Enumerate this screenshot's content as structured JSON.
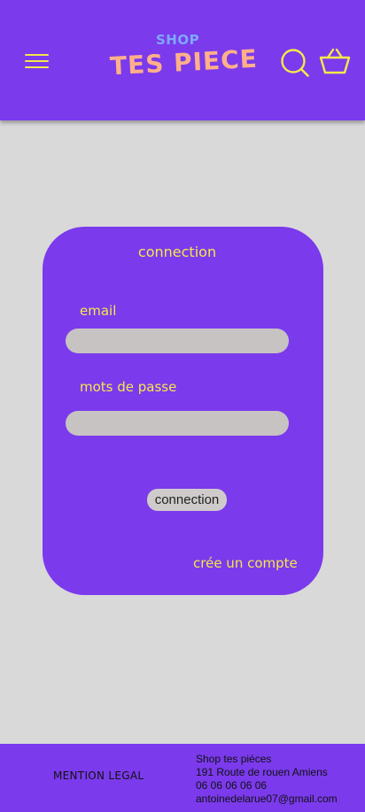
{
  "header": {
    "logo_top": "SHOP",
    "logo_main": "TES PIECE",
    "menu_icon": "hamburger-menu-icon",
    "search_icon": "search-icon",
    "basket_icon": "basket-icon"
  },
  "login": {
    "title": "connection",
    "email_label": "email",
    "email_value": "",
    "password_label": "mots de passe",
    "password_value": "",
    "submit_label": "connection",
    "create_account": "crée un compte"
  },
  "footer": {
    "legal": "MENTION LEGAL",
    "shop_name": "Shop tes piéces",
    "address": "191 Route de rouen Amiens",
    "phone": "06 06 06 06 06",
    "email": "antoinedelarue07@gmail.com"
  },
  "colors": {
    "primary": "#7b3aec",
    "accent": "#f5e84a",
    "background": "#d9d9d9",
    "input": "#c8c3c3",
    "logo_top": "#7fa8ff",
    "logo_main": "#ffb08a"
  }
}
